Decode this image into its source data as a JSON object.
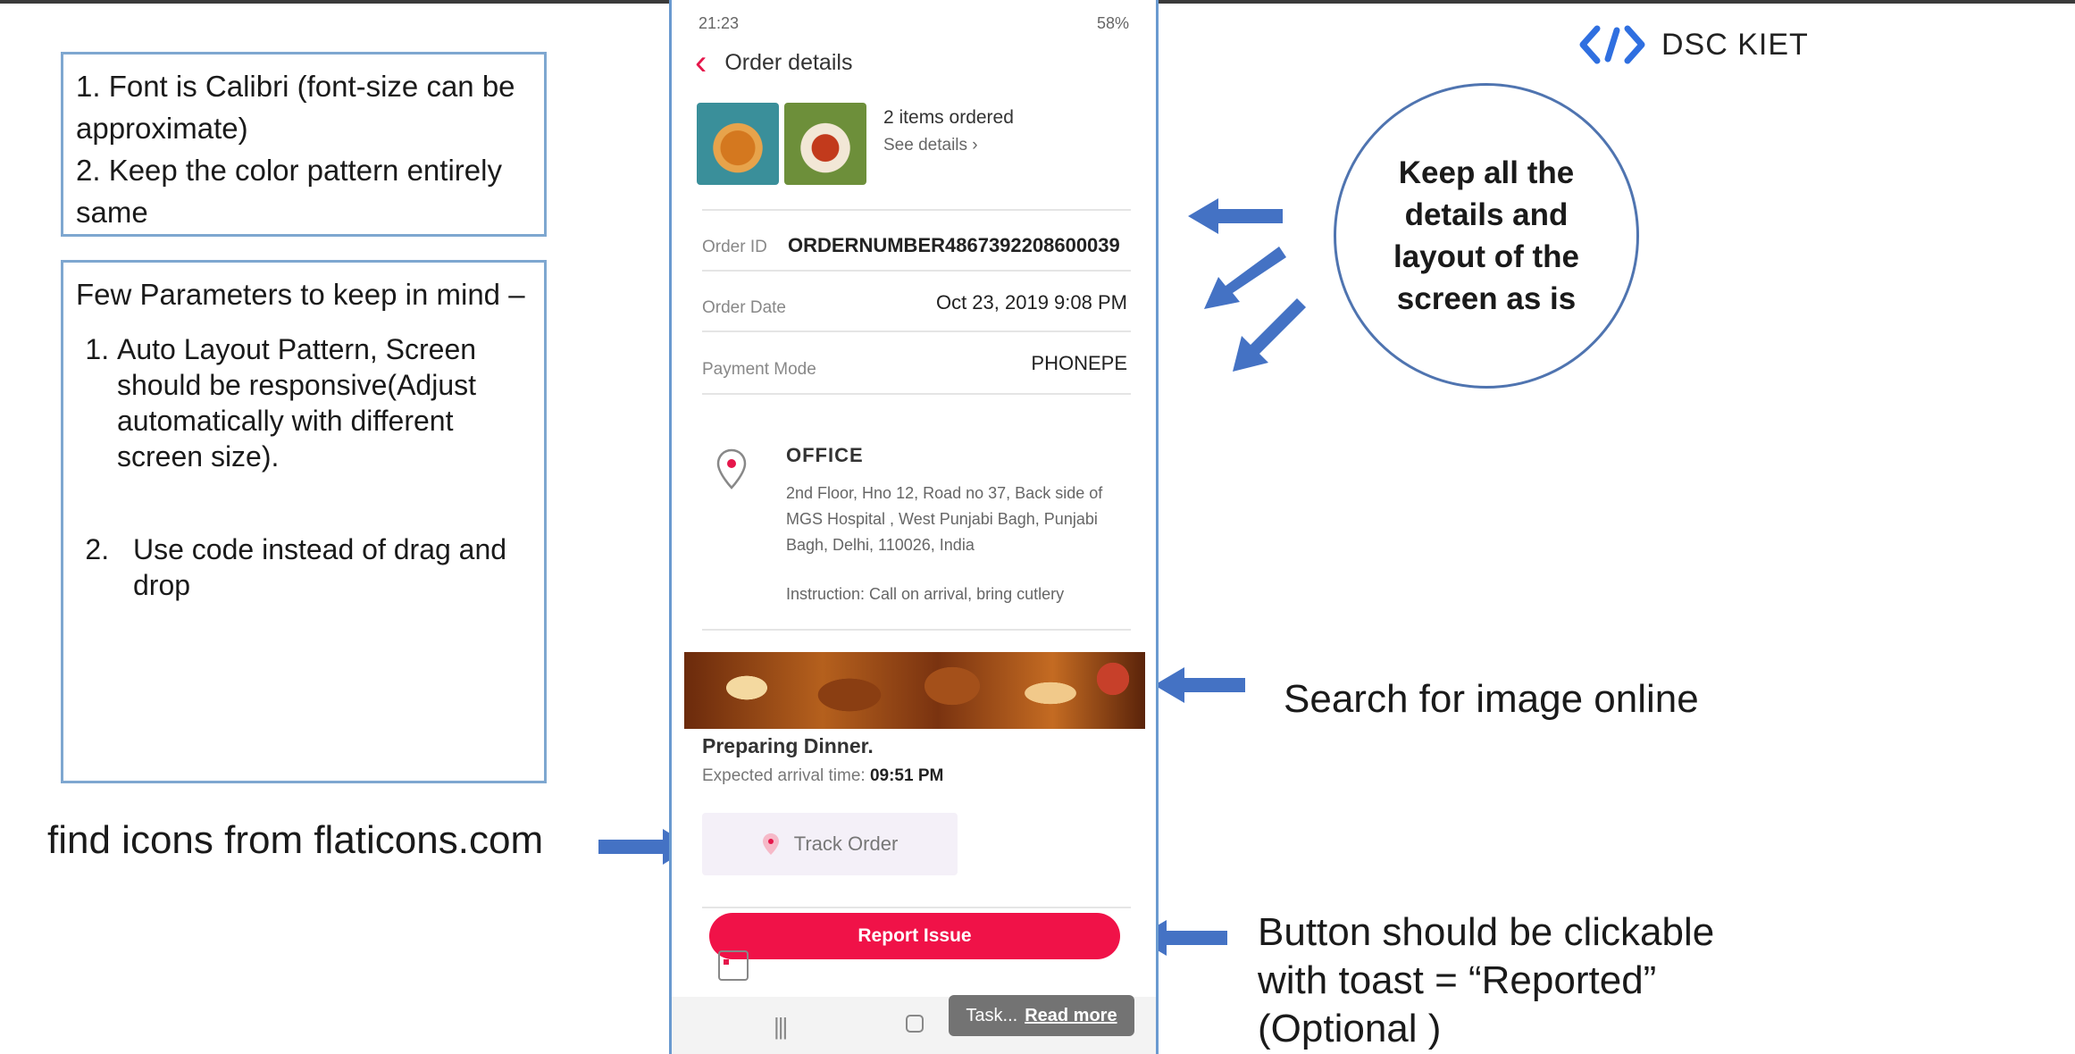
{
  "notes": {
    "box1": {
      "line1": "1. Font is Calibri (font-size can be approximate)",
      "line2": "2. Keep the color pattern entirely same"
    },
    "box2": {
      "title": "Few Parameters to keep in mind –",
      "items": [
        "Auto Layout Pattern, Screen should be responsive(Adjust automatically with different screen size).",
        "Use code instead of drag and drop"
      ]
    }
  },
  "annotations": {
    "icons": "find icons from flaticons.com",
    "circle": "Keep all the details and layout of the screen as is",
    "image": "Search for image online",
    "button": {
      "line1": "Button should be clickable",
      "line2": "with toast = “Reported”",
      "line3": "(Optional )"
    }
  },
  "logo": {
    "text": "DSC KIET",
    "icon": "code-brackets-icon"
  },
  "phone": {
    "status": {
      "time": "21:23",
      "battery": "58%"
    },
    "header": {
      "back_icon": "chevron-left-icon",
      "title": "Order details"
    },
    "items": {
      "count_text": "2 items ordered",
      "see_details": "See details ›"
    },
    "order": {
      "id_label": "Order ID",
      "id_value": "ORDERNUMBER4867392208600039",
      "date_label": "Order Date",
      "date_value": "Oct 23, 2019 9:08 PM",
      "payment_label": "Payment Mode",
      "payment_value": "PHONEPE"
    },
    "address": {
      "type": "OFFICE",
      "text": "2nd Floor, Hno 12, Road no 37, Back side of MGS Hospital , West Punjabi Bagh, Punjabi Bagh, Delhi, 110026, India",
      "instruction": "Instruction: Call on arrival, bring cutlery"
    },
    "status_section": {
      "title": "Preparing Dinner.",
      "expected_label": "Expected arrival time:",
      "expected_time": "09:51 PM"
    },
    "track_button": "Track Order",
    "report_button": "Report Issue",
    "toast": {
      "text": "Task...",
      "link": "Read more"
    },
    "nav": {
      "recents": "|||"
    }
  },
  "colors": {
    "accent": "#f01248",
    "back": "#e5174b",
    "note_border": "#7ea7d0",
    "arrow": "#4472c4",
    "circle_border": "#4f74b0"
  }
}
